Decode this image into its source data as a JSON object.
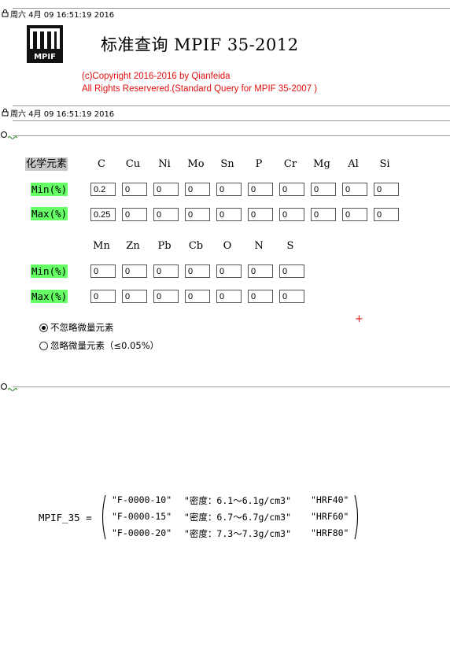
{
  "timestamp": "周六 4月 09 16:51:19 2016",
  "title": "标准查询 MPIF 35-2012",
  "logo_text": "MPIF",
  "copyright_line1": "(c)Copyright 2016-2016 by Qianfeida",
  "copyright_line2": "All Rights Reservered.(Standard Query for MPIF 35-2007 )",
  "chem_label": "化学元素",
  "min_label": "Min(%)",
  "max_label": "Max(%)",
  "elements_row1": [
    "C",
    "Cu",
    "Ni",
    "Mo",
    "Sn",
    "P",
    "Cr",
    "Mg",
    "Al",
    "Si"
  ],
  "min_row1": [
    "0.2",
    "0",
    "0",
    "0",
    "0",
    "0",
    "0",
    "0",
    "0",
    "0"
  ],
  "max_row1": [
    "0.25",
    "0",
    "0",
    "0",
    "0",
    "0",
    "0",
    "0",
    "0",
    "0"
  ],
  "elements_row2": [
    "Mn",
    "Zn",
    "Pb",
    "Cb",
    "O",
    "N",
    "S"
  ],
  "min_row2": [
    "0",
    "0",
    "0",
    "0",
    "0",
    "0",
    "0"
  ],
  "max_row2": [
    "0",
    "0",
    "0",
    "0",
    "0",
    "0",
    "0"
  ],
  "radio_options": [
    {
      "label": "不忽略微量元素",
      "selected": true
    },
    {
      "label": "忽略微量元素（≤0.05%）",
      "selected": false
    }
  ],
  "result_name": "MPIF_35 =",
  "result_rows": [
    [
      "\"F-0000-10\"",
      "\"密度：6.1～6.1g/cm3\"",
      "\"HRF40\""
    ],
    [
      "\"F-0000-15\"",
      "\"密度：6.7～6.7g/cm3\"",
      "\"HRF60\""
    ],
    [
      "\"F-0000-20\"",
      "\"密度：7.3～7.3g/cm3\"",
      "\"HRF80\""
    ]
  ],
  "colors": {
    "accent_green": "#66ff66",
    "copyright_red": "#e01010",
    "label_gray": "#c8c8c8"
  }
}
